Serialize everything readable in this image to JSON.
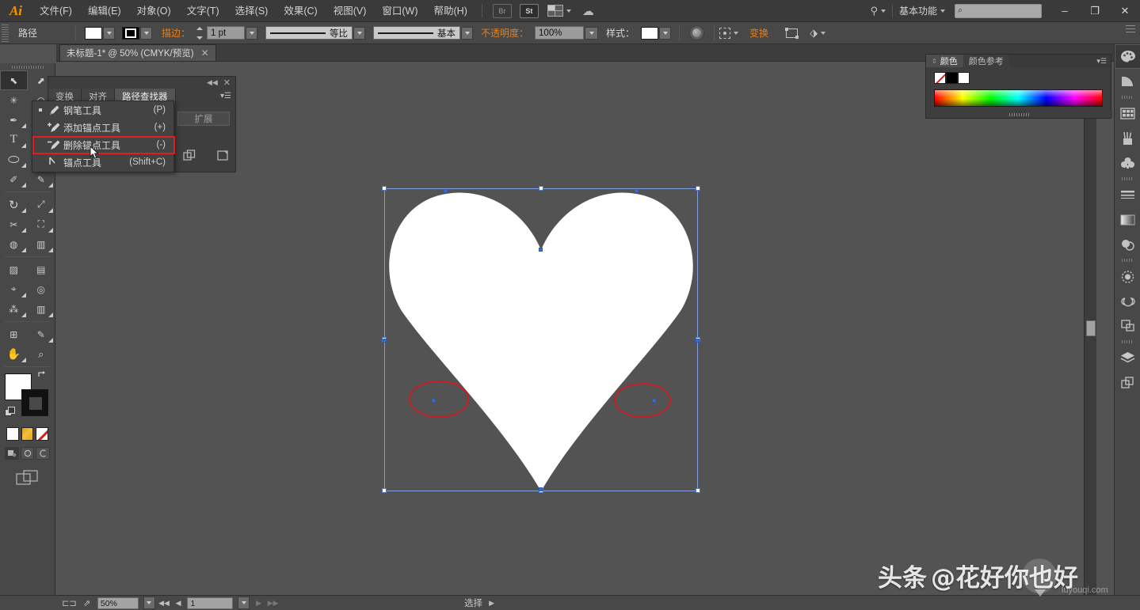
{
  "app": {
    "name": "Ai",
    "logo_text": "Ai"
  },
  "menubar": {
    "items": [
      {
        "label": "文件(F)"
      },
      {
        "label": "编辑(E)"
      },
      {
        "label": "对象(O)"
      },
      {
        "label": "文字(T)"
      },
      {
        "label": "选择(S)"
      },
      {
        "label": "效果(C)"
      },
      {
        "label": "视图(V)"
      },
      {
        "label": "窗口(W)"
      },
      {
        "label": "帮助(H)"
      }
    ],
    "bridge_label": "Br",
    "stock_label": "St",
    "arrange_icon": "arrange-documents-icon",
    "cc_icon": "creative-cloud-icon",
    "sync_icon": "sync-settings-icon",
    "workspace": "基本功能",
    "search_placeholder": "",
    "search_icon": "search-icon",
    "window_buttons": {
      "minimize": "–",
      "restore": "❐",
      "close": "✕"
    }
  },
  "controlbar": {
    "object_type": "路径",
    "fill_swatch": "#ffffff",
    "stroke_swatch": "#000000",
    "stroke_label": "描边：",
    "stroke_weight": "1 pt",
    "profile_label": "等比",
    "brush_label": "基本",
    "opacity_label": "不透明度：",
    "opacity_value": "100%",
    "style_label": "样式：",
    "style_swatch": "#ffffff",
    "recolor_icon": "recolor-artwork-icon",
    "align_icon": "align-dropdown-icon",
    "transform_label": "变换",
    "isolate_icon": "isolate-selected-icon",
    "shape_icon": "shape-tool-icon"
  },
  "document_tab": {
    "title": "未标题-1* @ 50% (CMYK/预览)",
    "close_glyph": "✕"
  },
  "toolbar": {
    "tools": [
      {
        "name": "selection-tool",
        "glyph": "⬉",
        "selected": true
      },
      {
        "name": "direct-selection-tool",
        "glyph": "⬈",
        "selected": false
      },
      {
        "name": "magic-wand-tool",
        "glyph": "✳",
        "selected": false
      },
      {
        "name": "lasso-tool",
        "glyph": "◠",
        "selected": false
      },
      {
        "name": "pen-tool",
        "glyph": "✒",
        "selected": false
      },
      {
        "name": "add-anchor-point-tool",
        "glyph": "✚",
        "selected": false
      },
      {
        "name": "type-tool",
        "glyph": "T",
        "selected": false
      },
      {
        "name": "line-segment-tool",
        "glyph": "╲",
        "selected": false
      },
      {
        "name": "ellipse-tool",
        "glyph": "⬭",
        "selected": false
      },
      {
        "name": "rectangle-tool",
        "glyph": "▭",
        "selected": false
      },
      {
        "name": "paintbrush-tool",
        "glyph": "🖌",
        "selected": false
      },
      {
        "name": "pencil-tool",
        "glyph": "✎",
        "selected": false
      },
      {
        "name": "rotate-tool",
        "glyph": "↻",
        "selected": false
      },
      {
        "name": "scale-tool",
        "glyph": "⤢",
        "selected": false
      },
      {
        "name": "width-tool",
        "glyph": "✂",
        "selected": false
      },
      {
        "name": "free-transform-tool",
        "glyph": "⛶",
        "selected": false
      },
      {
        "name": "shape-builder-tool",
        "glyph": "◍",
        "selected": false
      },
      {
        "name": "column-graph-tool",
        "glyph": "▥",
        "selected": false
      },
      {
        "name": "mesh-tool",
        "glyph": "▧",
        "selected": false
      },
      {
        "name": "gradient-tool",
        "glyph": "▤",
        "selected": false
      },
      {
        "name": "eyedropper-tool",
        "glyph": "⌖",
        "selected": false
      },
      {
        "name": "blend-tool",
        "glyph": "◎",
        "selected": false
      },
      {
        "name": "artboard-tool",
        "glyph": "⊞",
        "selected": false
      },
      {
        "name": "slice-tool",
        "glyph": "🔪",
        "selected": false
      },
      {
        "name": "hand-tool",
        "glyph": "✋",
        "selected": false
      },
      {
        "name": "zoom-tool",
        "glyph": "🔍",
        "selected": false
      }
    ],
    "fill_color": "#ffffff",
    "stroke_color": "#111111",
    "swap_icon": "swap-fill-stroke-icon",
    "default_icon": "default-fill-stroke-icon",
    "color_modes": [
      {
        "name": "color-mode",
        "label": ""
      },
      {
        "name": "gradient-mode",
        "label": ""
      },
      {
        "name": "none-mode",
        "label": ""
      }
    ],
    "draw_modes": [
      {
        "name": "draw-normal-mode"
      },
      {
        "name": "draw-behind-mode"
      },
      {
        "name": "draw-inside-mode"
      }
    ],
    "screen_mode_icon": "change-screen-mode-icon"
  },
  "pathfinder_panel": {
    "tabs": [
      {
        "label": "变换",
        "active": false
      },
      {
        "label": "对齐",
        "active": false
      },
      {
        "label": "路径查找器",
        "active": true
      }
    ],
    "expand_button": "扩展",
    "collapse_icon": "collapse-panel-icon",
    "close_icon": "close-panel-icon",
    "menu_icon": "panel-menu-icon"
  },
  "pen_flyout": {
    "items": [
      {
        "label": "钢笔工具",
        "shortcut": "(P)",
        "icon": "pen-tool-icon",
        "current": true,
        "highlighted": false
      },
      {
        "label": "添加锚点工具",
        "shortcut": "(+)",
        "icon": "add-anchor-point-icon",
        "current": false,
        "highlighted": false
      },
      {
        "label": "删除锚点工具",
        "shortcut": "(-)",
        "icon": "delete-anchor-point-icon",
        "current": false,
        "highlighted": true
      },
      {
        "label": "锚点工具",
        "shortcut": "(Shift+C)",
        "icon": "anchor-point-icon",
        "current": false,
        "highlighted": false
      }
    ],
    "highlight_color": "#e02020",
    "cursor_icon": "mouse-cursor-icon"
  },
  "color_panel": {
    "tabs": [
      {
        "label": "颜色",
        "active": true
      },
      {
        "label": "颜色参考",
        "active": false
      }
    ],
    "swatches": [
      {
        "name": "none-swatch",
        "color": "none"
      },
      {
        "name": "black-swatch",
        "color": "#000000"
      },
      {
        "name": "white-swatch",
        "color": "#ffffff"
      }
    ],
    "spectrum_name": "color-spectrum-ramp",
    "menu_icon": "panel-menu-icon"
  },
  "right_dock": {
    "items": [
      {
        "name": "color-panel-icon",
        "glyph": "🎨",
        "active": true
      },
      {
        "name": "color-guide-panel-icon",
        "glyph": "◴",
        "active": false
      },
      {
        "name": "swatches-panel-icon",
        "glyph": "▦",
        "active": false
      },
      {
        "name": "brushes-panel-icon",
        "glyph": "🖌",
        "active": false
      },
      {
        "name": "symbols-panel-icon",
        "glyph": "♣",
        "active": false
      },
      {
        "name": "stroke-panel-icon",
        "glyph": "☰",
        "active": false
      },
      {
        "name": "gradient-panel-icon",
        "glyph": "▤",
        "active": false
      },
      {
        "name": "transparency-panel-icon",
        "glyph": "◍",
        "active": false
      },
      {
        "name": "appearance-panel-icon",
        "glyph": "◉",
        "active": false
      },
      {
        "name": "cc-libraries-panel-icon",
        "glyph": "∞",
        "active": false
      },
      {
        "name": "artboards-panel-icon",
        "glyph": "⧉",
        "active": false
      },
      {
        "name": "layers-panel-icon",
        "glyph": "◆",
        "active": false
      },
      {
        "name": "pathfinder-panel-icon",
        "glyph": "❏",
        "active": false
      }
    ]
  },
  "canvas": {
    "shape_name": "heart-path",
    "shape_fill": "#ffffff",
    "selection_color": "#7d9fe0",
    "annotation_color": "#c41f23",
    "annotations": [
      {
        "name": "left-anchor-callout"
      },
      {
        "name": "right-anchor-callout"
      }
    ]
  },
  "statusbar": {
    "zoom": "50%",
    "page": "1",
    "status_text": "选择",
    "first_icon": "artboard-navigation-icon",
    "share_icon": "share-on-behance-icon",
    "nav_first": "◀◀",
    "nav_prev": "◀",
    "nav_next": "▶",
    "nav_last": "▶▶",
    "expand_arrow": "▶"
  },
  "watermark": {
    "brand": "头条",
    "handle": "@花好你也好",
    "site": "luyouqi.com"
  }
}
